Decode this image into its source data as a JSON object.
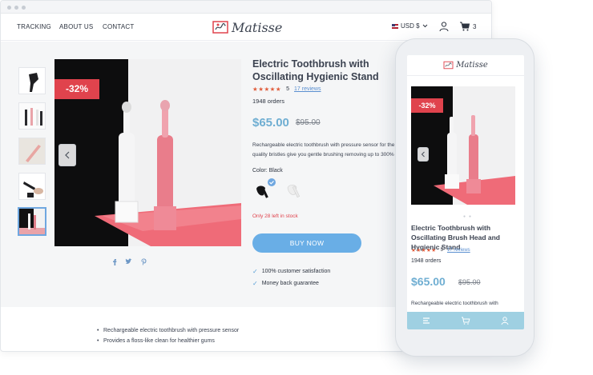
{
  "nav": {
    "tracking": "TRACKING",
    "about": "ABOUT US",
    "contact": "CONTACT",
    "logo": "Matisse",
    "currency": "USD $",
    "cart_count": "3"
  },
  "product": {
    "discount": "-32%",
    "title": "Electric Toothbrush with Oscillating Hygienic Stand",
    "rating_value": "5",
    "reviews": "17 reviews",
    "orders": "1948 orders",
    "price": "$65.00",
    "old_price": "$95.00",
    "description_line1": "Rechargeable electric toothbrush with pressure sensor for the",
    "description_line2": "quality bristles give you gentle brushing removing up to 300%",
    "color_label": "Color: Black",
    "stock": "Only 28 left in stock",
    "buy_label": "BUY NOW",
    "guarantee1": "100% customer satisfaction",
    "guarantee2": "Money back guarantee",
    "bullets": [
      "Rechargeable electric toothbrush with pressure sensor",
      "Provides a floss-like clean for healthier gums"
    ]
  },
  "mobile": {
    "logo": "Matisse",
    "discount": "-32%",
    "title": "Electric Toothbrush with Oscillating Brush Head and Hygienic Stand",
    "rating_value": "5",
    "reviews": "17 reviews",
    "orders": "1948 orders",
    "price": "$65.00",
    "old_price": "$95.00",
    "description": "Rechargeable electric toothbrush with"
  },
  "icons": {
    "user": "user-icon",
    "cart": "cart-icon",
    "prev": "chevron-left-icon",
    "facebook": "facebook-icon",
    "twitter": "twitter-icon",
    "pinterest": "pinterest-icon",
    "menu": "menu-icon"
  },
  "colors": {
    "accent": "#69aee6",
    "price": "#6faed2",
    "discount": "#e0434d",
    "stars": "#e05d3c",
    "mobile_nav": "#9fd0e2"
  },
  "ratings": {
    "desktop_stars": 5,
    "mobile_stars": 5
  }
}
